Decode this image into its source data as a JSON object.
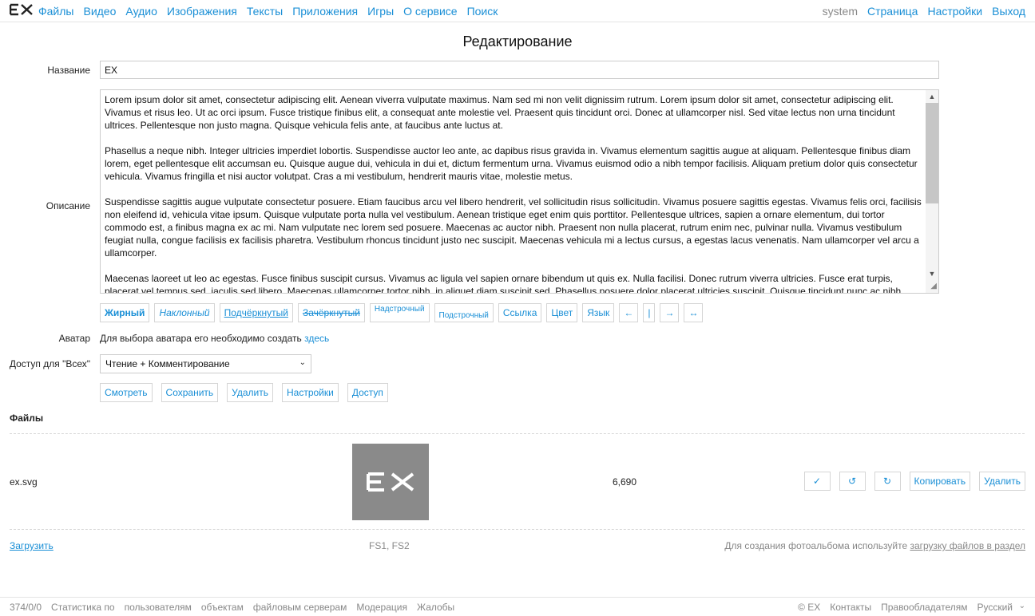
{
  "nav": {
    "logo": "EX",
    "items": [
      "Файлы",
      "Видео",
      "Аудио",
      "Изображения",
      "Тексты",
      "Приложения",
      "Игры",
      "О сервисе",
      "Поиск"
    ],
    "user": "system",
    "right_items": [
      "Страница",
      "Настройки",
      "Выход"
    ]
  },
  "page": {
    "title": "Редактирование"
  },
  "form": {
    "name_label": "Название",
    "name_value": "EX",
    "description_label": "Описание",
    "description_paragraphs": [
      "Lorem ipsum dolor sit amet, consectetur adipiscing elit. Aenean viverra vulputate maximus. Nam sed mi non velit dignissim rutrum. Lorem ipsum dolor sit amet, consectetur adipiscing elit. Vivamus et risus leo. Ut ac orci ipsum. Fusce tristique finibus elit, a consequat ante molestie vel. Praesent quis tincidunt orci. Donec at ullamcorper nisl. Sed vitae lectus non urna tincidunt ultrices. Pellentesque non justo magna. Quisque vehicula felis ante, at faucibus ante luctus at.",
      "Phasellus a neque nibh. Integer ultricies imperdiet lobortis. Suspendisse auctor leo ante, ac dapibus risus gravida in. Vivamus elementum sagittis augue at aliquam. Pellentesque finibus diam lorem, eget pellentesque elit accumsan eu. Quisque augue dui, vehicula in dui et, dictum fermentum urna. Vivamus euismod odio a nibh tempor facilisis. Aliquam pretium dolor quis consectetur vehicula. Vivamus fringilla et nisi auctor volutpat. Cras a mi vestibulum, hendrerit mauris vitae, molestie metus.",
      "Suspendisse sagittis augue vulputate consectetur posuere. Etiam faucibus arcu vel libero hendrerit, vel sollicitudin risus sollicitudin. Vivamus posuere sagittis egestas. Vivamus felis orci, facilisis non eleifend id, vehicula vitae ipsum. Quisque vulputate porta nulla vel vestibulum. Aenean tristique eget enim quis porttitor. Pellentesque ultrices, sapien a ornare elementum, dui tortor commodo est, a finibus magna ex ac mi. Nam vulputate nec lorem sed posuere. Maecenas ac auctor nibh. Praesent non nulla placerat, rutrum enim nec, pulvinar nulla. Vivamus vestibulum feugiat nulla, congue facilisis ex facilisis pharetra. Vestibulum rhoncus tincidunt justo nec suscipit. Maecenas vehicula mi a lectus cursus, a egestas lacus venenatis. Nam ullamcorper vel arcu a ullamcorper.",
      "Maecenas laoreet ut leo ac egestas. Fusce finibus suscipit cursus. Vivamus ac ligula vel sapien ornare bibendum ut quis ex. Nulla facilisi. Donec rutrum viverra ultricies. Fusce erat turpis, placerat vel tempus sed, iaculis sed libero. Maecenas ullamcorper tortor nibh, in aliquet diam suscipit sed. Phasellus posuere dolor placerat ultricies suscipit. Quisque tincidunt nunc ac nibh"
    ],
    "format_buttons": {
      "bold": "Жирный",
      "italic": "Наклонный",
      "underline": "Подчёркнутый",
      "strike": "Зачёркнутый",
      "sup": "Надстрочный",
      "sub": "Подстрочный",
      "link": "Ссылка",
      "color": "Цвет",
      "lang": "Язык",
      "align_left": "←",
      "align_center": "|",
      "align_right": "→",
      "align_justify": "↔"
    },
    "avatar_label": "Аватар",
    "avatar_text": "Для выбора аватара его необходимо создать",
    "avatar_link": "здесь",
    "access_label": "Доступ для \"Всех\"",
    "access_value": "Чтение + Комментирование",
    "actions": {
      "view": "Смотреть",
      "save": "Сохранить",
      "delete": "Удалить",
      "settings": "Настройки",
      "access": "Доступ"
    }
  },
  "files": {
    "title": "Файлы",
    "items": [
      {
        "name": "ex.svg",
        "size": "6,690",
        "thumb_text": "EX",
        "actions": {
          "apply": "✓",
          "rotate_left": "↺",
          "rotate_right": "↻",
          "copy": "Копировать",
          "delete": "Удалить"
        }
      }
    ],
    "upload": "Загрузить",
    "servers": "FS1, FS2",
    "album_note": "Для создания фотоальбома используйте",
    "album_link": "загрузку файлов в раздел"
  },
  "footer": {
    "counts": "374/0/0",
    "stats_label": "Статистика по",
    "stats_users": "пользователям",
    "stats_objects": "объектам",
    "stats_servers": "файловым серверам",
    "moderation": "Модерация",
    "complaints": "Жалобы",
    "copyright": "© EX",
    "contacts": "Контакты",
    "rights": "Правообладателям",
    "language": "Русский"
  },
  "colors": {
    "link": "#1a8fd6",
    "muted": "#888888",
    "thumb_bg": "#8a8a8a"
  }
}
